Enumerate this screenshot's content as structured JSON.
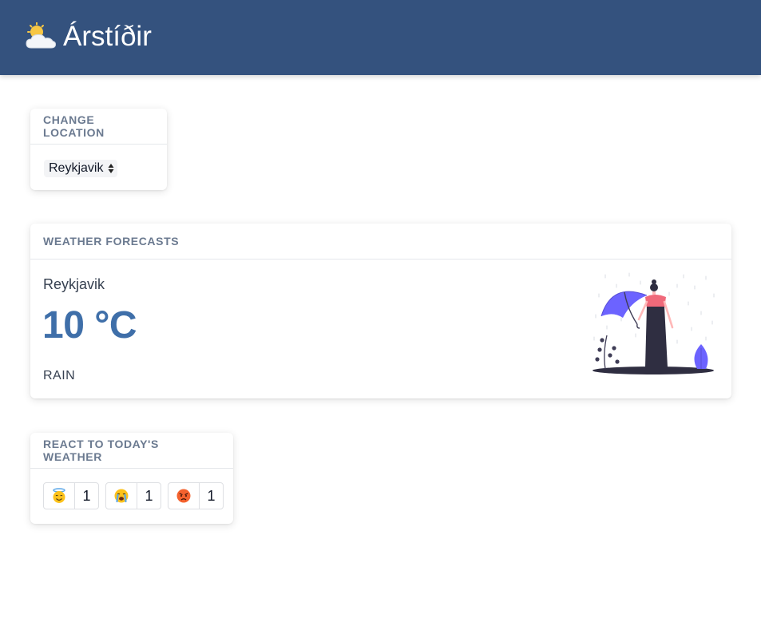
{
  "header": {
    "title": "Árstíðir",
    "logo_icon": "sun-behind-cloud-icon"
  },
  "location_card": {
    "heading": "CHANGE LOCATION",
    "selected": "Reykjavik",
    "arrows_icon": "select-arrows-icon"
  },
  "forecast_card": {
    "heading": "WEATHER FORECASTS",
    "city": "Reykjavik",
    "temperature": "10 °C",
    "condition": "RAIN",
    "illustration": "woman-with-umbrella-in-rain"
  },
  "reactions_card": {
    "heading": "REACT TO TODAY'S WEATHER",
    "reactions": [
      {
        "icon": "smiling-face-with-halo-icon",
        "count": "1"
      },
      {
        "icon": "loudly-crying-face-icon",
        "count": "1"
      },
      {
        "icon": "pouting-face-icon",
        "count": "1"
      }
    ]
  },
  "colors": {
    "header_bg": "#34527e",
    "temperature": "#3f6fa9",
    "heading_text": "#6b7a90",
    "illustration_accent": "#6c63ff",
    "illustration_pink": "#f0697a"
  }
}
